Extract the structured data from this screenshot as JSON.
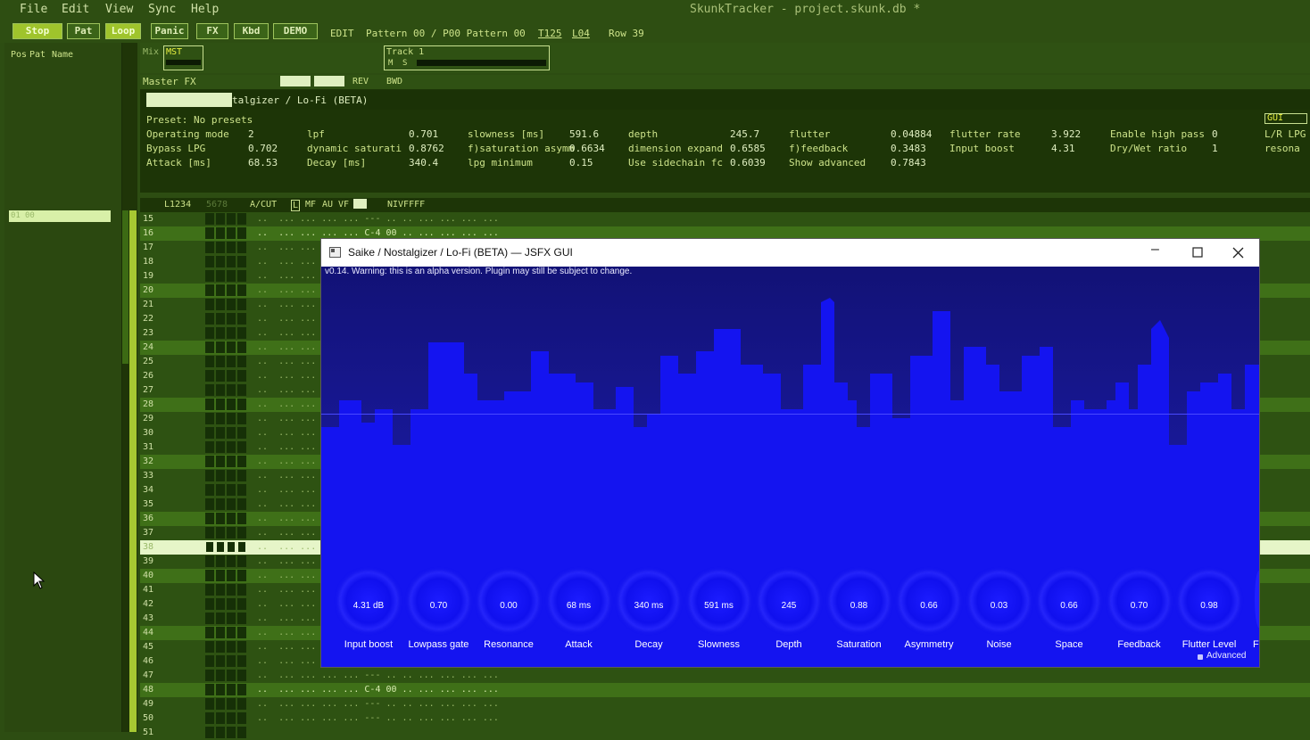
{
  "menu": [
    "File",
    "Edit",
    "View",
    "Sync",
    "Help"
  ],
  "window_title": "SkunkTracker - project.skunk.db *",
  "toolbar": {
    "stop": "Stop",
    "pat": "Pat",
    "loop": "Loop",
    "panic": "Panic",
    "fx": "FX",
    "kbd": "Kbd",
    "demo": "DEMO",
    "mode": "EDIT",
    "pattern": "Pattern 00 / P00 Pattern 00",
    "tempo": "T125",
    "length": "L04",
    "row": "Row 39"
  },
  "patlist": {
    "headers": [
      "Pos",
      "Pat",
      "Name"
    ],
    "entry_pos": "01",
    "entry_pat": "00"
  },
  "mixer": {
    "mix": "Mix",
    "mst": "MST",
    "track_name": "Track 1",
    "mute": "M",
    "solo": "S"
  },
  "masterfx": {
    "label": "Master FX",
    "rev": "REV",
    "bwd": "BWD",
    "plugin_name": "talgizer / Lo-Fi (BETA)",
    "preset": "Preset: No presets",
    "gui": "GUI",
    "params": [
      [
        "Operating mode",
        "2"
      ],
      [
        "Bypass LPG",
        "0.702"
      ],
      [
        "Attack [ms]",
        "68.53"
      ],
      [
        "lpf",
        "0.701"
      ],
      [
        "dynamic saturati",
        "0.8762"
      ],
      [
        "Decay [ms]",
        "340.4"
      ],
      [
        "slowness [ms]",
        "591.6"
      ],
      [
        "f)saturation asymm",
        "0.6634"
      ],
      [
        "lpg minimum",
        "0.15"
      ],
      [
        "depth",
        "245.7"
      ],
      [
        "dimension expand",
        "0.6585"
      ],
      [
        "Use sidechain fc",
        "0.6039"
      ],
      [
        "flutter",
        "0.04884"
      ],
      [
        "f)feedback",
        "0.3483"
      ],
      [
        "Show advanced",
        "0.7843"
      ],
      [
        "flutter rate",
        "3.922"
      ],
      [
        "Input boost",
        "4.31"
      ],
      [
        "Enable high pass",
        "0"
      ],
      [
        "Dry/Wet ratio",
        "1"
      ],
      [
        "L/R LPG",
        ""
      ],
      [
        "resona",
        ""
      ]
    ]
  },
  "grid": {
    "header": {
      "tracks": "L1234",
      "cols": "5678",
      "acut": "A/CUT",
      "l": "L",
      "mf": "MF",
      "au": "AU",
      "vf": "VF",
      "nivffff": "NIVFFFF"
    },
    "rows": [
      {
        "n": "15",
        "t": "..  ... ... ... ... --- .. .. ... ... ... ..."
      },
      {
        "n": "16",
        "t": "..  ... ... ... ... C-4 00 .. ... ... ... ..."
      },
      {
        "n": "17",
        "t": "..  ... ..."
      },
      {
        "n": "18",
        "t": "..  ... ..."
      },
      {
        "n": "19",
        "t": "..  ... ..."
      },
      {
        "n": "20",
        "t": "..  ... ..."
      },
      {
        "n": "21",
        "t": "..  ... ..."
      },
      {
        "n": "22",
        "t": "..  ... ..."
      },
      {
        "n": "23",
        "t": "..  ... ..."
      },
      {
        "n": "24",
        "t": "..  ... ..."
      },
      {
        "n": "25",
        "t": "..  ... ..."
      },
      {
        "n": "26",
        "t": "..  ... ..."
      },
      {
        "n": "27",
        "t": "..  ... ..."
      },
      {
        "n": "28",
        "t": "..  ... ..."
      },
      {
        "n": "29",
        "t": "..  ... ..."
      },
      {
        "n": "30",
        "t": "..  ... ..."
      },
      {
        "n": "31",
        "t": "..  ... ..."
      },
      {
        "n": "32",
        "t": "..  ... ..."
      },
      {
        "n": "33",
        "t": "..  ... ..."
      },
      {
        "n": "34",
        "t": "..  ... ..."
      },
      {
        "n": "35",
        "t": "..  ... ..."
      },
      {
        "n": "36",
        "t": "..  ... ..."
      },
      {
        "n": "37",
        "t": "..  ... ..."
      },
      {
        "n": "38",
        "t": "..  ... ..."
      },
      {
        "n": "39",
        "t": "..  ... ..."
      },
      {
        "n": "40",
        "t": "..  ... ..."
      },
      {
        "n": "41",
        "t": "..  ... ..."
      },
      {
        "n": "42",
        "t": "..  ... ..."
      },
      {
        "n": "43",
        "t": "..  ... ..."
      },
      {
        "n": "44",
        "t": "..  ... ..."
      },
      {
        "n": "45",
        "t": "..  ... ..."
      },
      {
        "n": "46",
        "t": "..  ... ..."
      },
      {
        "n": "47",
        "t": "..  ... ... ... ... --- .. .. ... ... ... ..."
      },
      {
        "n": "48",
        "t": "..  ... ... ... ... C-4 00 .. ... ... ... ..."
      },
      {
        "n": "49",
        "t": "..  ... ... ... ... --- .. .. ... ... ... ..."
      },
      {
        "n": "50",
        "t": "..  ... ... ... ... --- .. .. ... ... ... ..."
      },
      {
        "n": "51",
        "t": ""
      }
    ]
  },
  "plugin": {
    "title": "Saike / Nostalgizer / Lo-Fi (BETA) — JSFX GUI",
    "warning": "v0.14. Warning: this is an alpha version. Plugin may still be subject to change.",
    "knobs": [
      {
        "value": "4.31 dB",
        "label": "Input boost"
      },
      {
        "value": "0.70",
        "label": "Lowpass gate"
      },
      {
        "value": "0.00",
        "label": "Resonance"
      },
      {
        "value": "68 ms",
        "label": "Attack"
      },
      {
        "value": "340 ms",
        "label": "Decay"
      },
      {
        "value": "591 ms",
        "label": "Slowness"
      },
      {
        "value": "245",
        "label": "Depth"
      },
      {
        "value": "0.88",
        "label": "Saturation"
      },
      {
        "value": "0.66",
        "label": "Asymmetry"
      },
      {
        "value": "0.03",
        "label": "Noise"
      },
      {
        "value": "0.66",
        "label": "Space"
      },
      {
        "value": "0.70",
        "label": "Feedback"
      },
      {
        "value": "0.98",
        "label": "Flutter Level"
      }
    ],
    "advanced": "Advanced"
  }
}
